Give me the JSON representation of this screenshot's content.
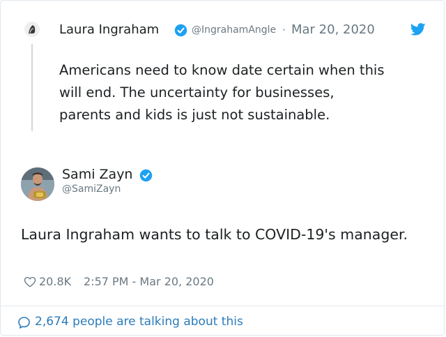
{
  "quoted_tweet": {
    "author_name": "Laura Ingraham",
    "handle": "@IngrahamAngle",
    "separator": "·",
    "date": "Mar 20, 2020",
    "text": "Americans need to know date certain when this\nwill end.  The uncertainty for businesses,\nparents and kids is just not sustainable.",
    "avatar_icon": "avatar-icon",
    "verified_icon": "verified-badge-icon",
    "brand_icon": "twitter-bird-icon"
  },
  "main_tweet": {
    "author_name": "Sami Zayn",
    "handle": "@SamiZayn",
    "text": "Laura Ingraham wants to talk to COVID-19's manager.",
    "likes": "20.8K",
    "timestamp": "2:57 PM - Mar 20, 2020",
    "avatar_icon": "avatar-icon",
    "verified_icon": "verified-badge-icon",
    "like_icon": "heart-icon"
  },
  "footer": {
    "talking_text": "2,674 people are talking about this",
    "icon": "speech-bubble-icon"
  },
  "colors": {
    "verified": "#1da1f2",
    "link": "#2b7bb9",
    "muted": "#697882",
    "text": "#1c2022",
    "border": "#e1e8ed"
  }
}
